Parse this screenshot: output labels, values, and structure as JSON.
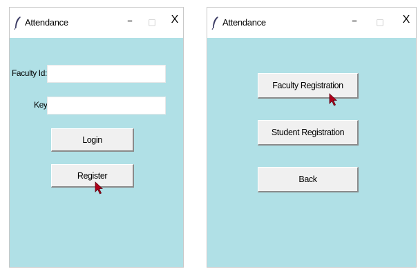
{
  "login_window": {
    "title": "Attendance",
    "controls": {
      "minimize": "–",
      "maximize": "□",
      "close": "X"
    },
    "faculty_id_label": "Faculty Id:",
    "faculty_id_value": "",
    "key_label": "Key:",
    "key_value": "",
    "login_button": "Login",
    "register_button": "Register"
  },
  "menu_window": {
    "title": "Attendance",
    "controls": {
      "minimize": "–",
      "maximize": "□",
      "close": "X"
    },
    "buttons": {
      "faculty_registration": "Faculty Registration",
      "student_registration": "Student Registration",
      "back": "Back"
    }
  },
  "theme": {
    "window_bg": "#b0e0e6",
    "button_bg": "#f0f0f0",
    "cursor_color": "#b0001a"
  }
}
